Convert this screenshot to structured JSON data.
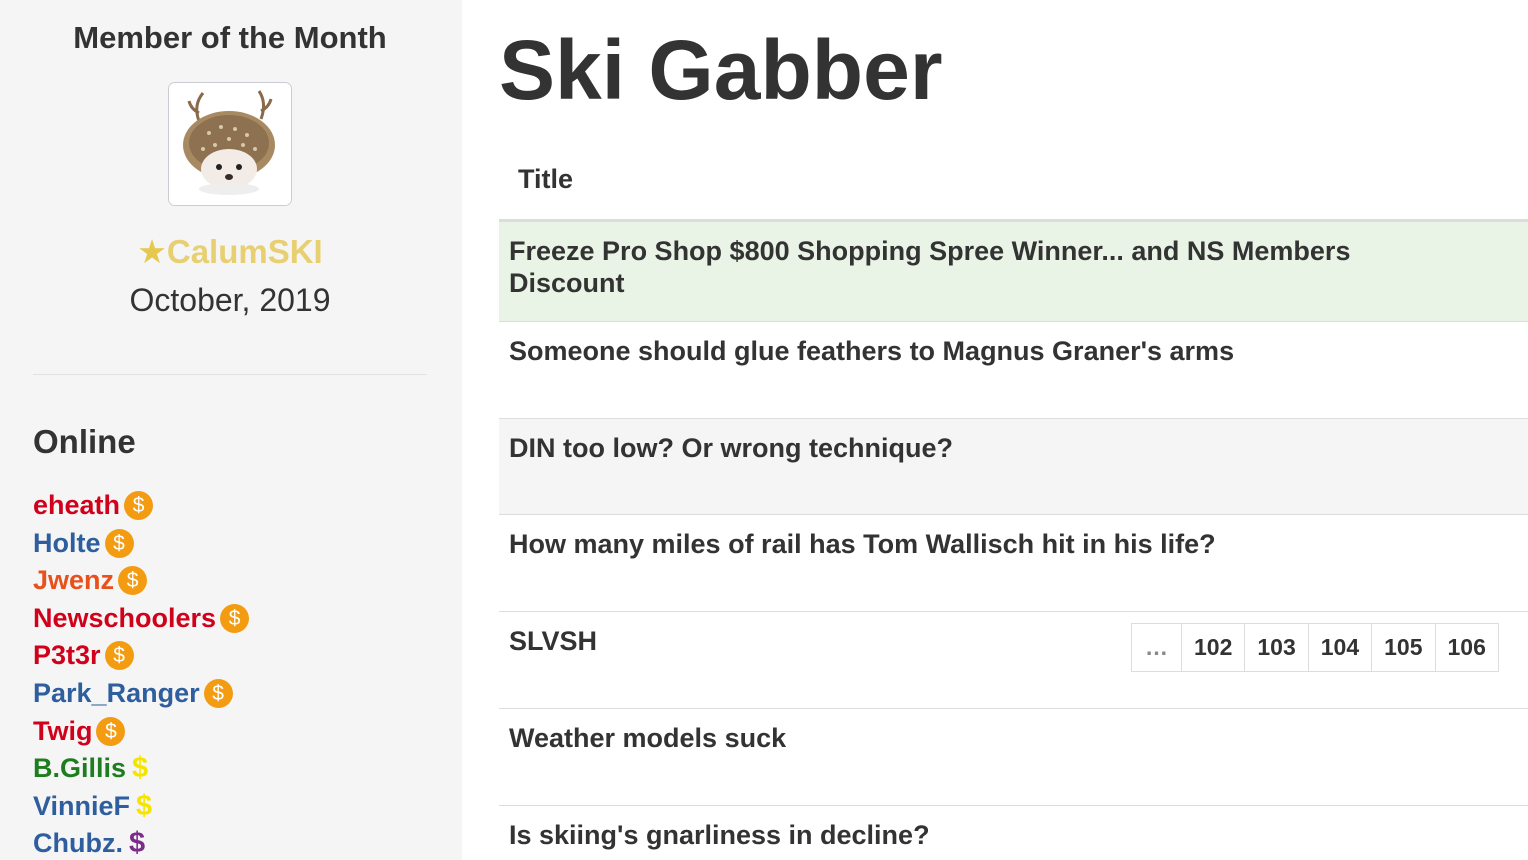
{
  "sidebar": {
    "motm_heading": "Member of the Month",
    "motm_name": "CalumSKI",
    "motm_star": "★",
    "motm_date": "October, 2019",
    "online_heading": "Online",
    "online_users": [
      {
        "name": "eheath",
        "color": "#d0021b",
        "badge": "coin",
        "badge_symbol": "$"
      },
      {
        "name": "Holte",
        "color": "#2f5e9e",
        "badge": "coin",
        "badge_symbol": "$"
      },
      {
        "name": "Jwenz",
        "color": "#e8501c",
        "badge": "coin",
        "badge_symbol": "$"
      },
      {
        "name": "Newschoolers",
        "color": "#d0021b",
        "badge": "coin",
        "badge_symbol": "$"
      },
      {
        "name": "P3t3r",
        "color": "#d0021b",
        "badge": "coin",
        "badge_symbol": "$"
      },
      {
        "name": "Park_Ranger",
        "color": "#2f5e9e",
        "badge": "coin",
        "badge_symbol": "$"
      },
      {
        "name": "Twig",
        "color": "#d0021b",
        "badge": "coin",
        "badge_symbol": "$"
      },
      {
        "name": "B.Gillis",
        "color": "#1e7d1e",
        "badge": "dollar",
        "badge_symbol": "$",
        "badge_color": "#f5e400"
      },
      {
        "name": "VinnieF",
        "color": "#2f5e9e",
        "badge": "dollar",
        "badge_symbol": "$",
        "badge_color": "#f5e400"
      },
      {
        "name": "Chubz.",
        "color": "#2f5e9e",
        "badge": "dollar",
        "badge_symbol": "$",
        "badge_color": "#7b2c8a"
      }
    ]
  },
  "main": {
    "site_title": "Ski Gabber",
    "column_header": "Title",
    "threads": [
      {
        "title": "Freeze Pro Shop $800 Shopping Spree Winner... and NS Members Discount",
        "highlight": "#e9f4e6"
      },
      {
        "title": "Someone should glue feathers to Magnus Graner's arms",
        "highlight": "#ffffff"
      },
      {
        "title": "DIN too low? Or wrong technique?",
        "highlight": "#f5f5f5"
      },
      {
        "title": "How many miles of rail has Tom Wallisch hit in his life?",
        "highlight": "#ffffff"
      },
      {
        "title": "SLVSH",
        "highlight": "#ffffff",
        "pages": [
          "…",
          "102",
          "103",
          "104",
          "105",
          "106"
        ]
      },
      {
        "title": "Weather models suck",
        "highlight": "#ffffff"
      },
      {
        "title": "Is skiing's gnarliness in decline?",
        "highlight": "#ffffff"
      }
    ]
  },
  "colors": {
    "sidebar_bg": "#f5f5f5",
    "text": "#333333",
    "motm_gold": "#e8cf72",
    "coin_orange": "#f39c12"
  }
}
